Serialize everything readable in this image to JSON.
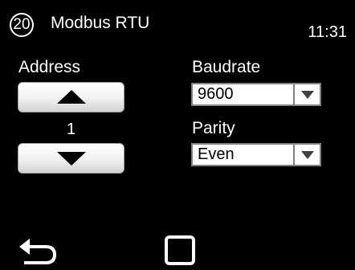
{
  "header": {
    "screen_number": "20",
    "title": "Modbus RTU",
    "time": "11:31"
  },
  "address": {
    "label": "Address",
    "value": "1",
    "up_icon": "arrow-up-icon",
    "down_icon": "arrow-down-icon"
  },
  "baudrate": {
    "label": "Baudrate",
    "selected": "9600",
    "dropdown_icon": "chevron-down-icon"
  },
  "parity": {
    "label": "Parity",
    "selected": "Even",
    "dropdown_icon": "chevron-down-icon"
  },
  "nav": {
    "back_icon": "back-arrow-icon",
    "home_icon": "home-square-icon"
  }
}
